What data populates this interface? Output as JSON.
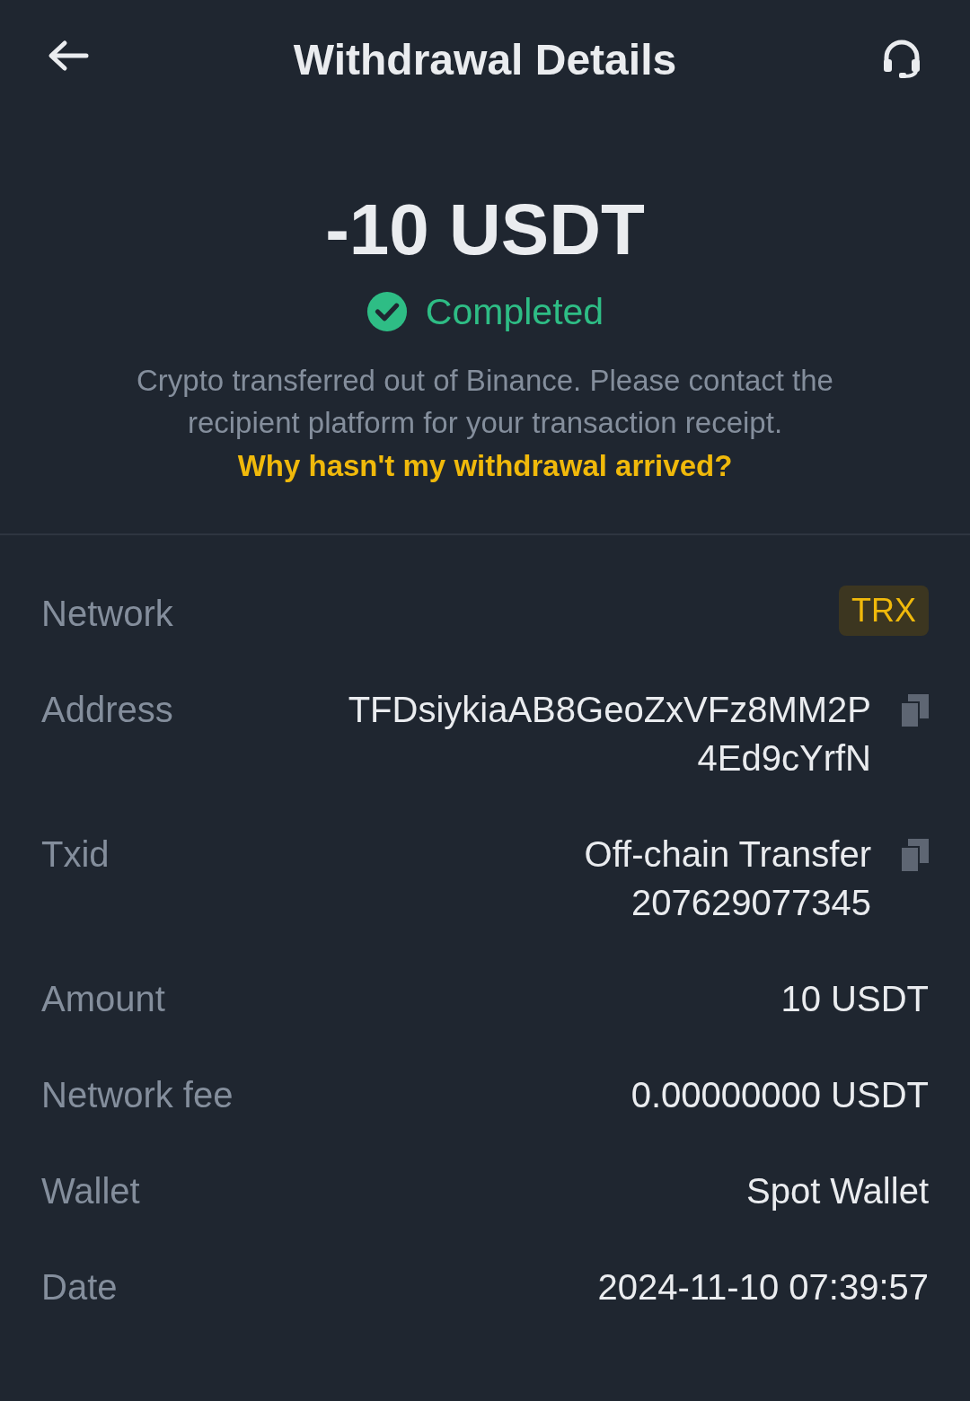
{
  "header": {
    "title": "Withdrawal Details"
  },
  "summary": {
    "amount": "-10 USDT",
    "status": "Completed",
    "description": "Crypto transferred out of Binance. Please contact the recipient platform for your transaction receipt.",
    "help_link": "Why hasn't my withdrawal arrived?"
  },
  "details": [
    {
      "kind": "badge",
      "label": "Network",
      "lines": [
        "TRX"
      ]
    },
    {
      "kind": "copyable",
      "label": "Address",
      "lines": [
        "TFDsiykiaAB8GeoZxVFz8MM2P",
        "4Ed9cYrfN"
      ]
    },
    {
      "kind": "copyable",
      "label": "Txid",
      "lines": [
        "Off-chain Transfer",
        "207629077345"
      ]
    },
    {
      "kind": "plain",
      "label": "Amount",
      "lines": [
        "10 USDT"
      ]
    },
    {
      "kind": "plain",
      "label": "Network fee",
      "lines": [
        "0.00000000 USDT"
      ]
    },
    {
      "kind": "plain",
      "label": "Wallet",
      "lines": [
        "Spot Wallet"
      ]
    },
    {
      "kind": "plain",
      "label": "Date",
      "lines": [
        "2024-11-10 07:39:57"
      ]
    }
  ]
}
